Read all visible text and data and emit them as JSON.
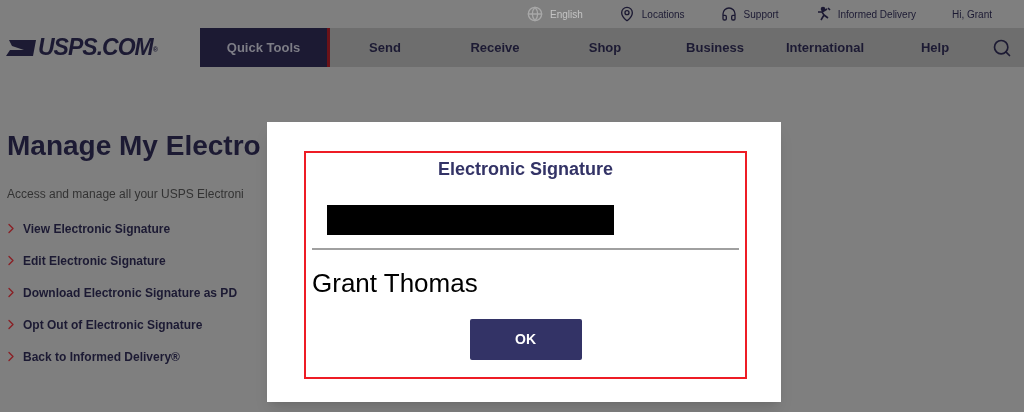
{
  "utility_bar": [
    {
      "kind": "language",
      "label": "English",
      "disabled": true
    },
    {
      "kind": "location",
      "label": "Locations",
      "disabled": false
    },
    {
      "kind": "support",
      "label": "Support",
      "disabled": false
    },
    {
      "kind": "delivery",
      "label": "Informed Delivery",
      "disabled": false
    },
    {
      "kind": "user",
      "label": "Hi, Grant",
      "disabled": false
    }
  ],
  "logo": {
    "text": "USPS.COM",
    "mark": "®"
  },
  "nav": [
    {
      "label": "Quick Tools",
      "selected": true
    },
    {
      "label": "Send",
      "selected": false
    },
    {
      "label": "Receive",
      "selected": false
    },
    {
      "label": "Shop",
      "selected": false
    },
    {
      "label": "Business",
      "selected": false
    },
    {
      "label": "International",
      "selected": false
    },
    {
      "label": "Help",
      "selected": false
    }
  ],
  "page": {
    "heading": "Manage My Electro",
    "intro": "Access and manage all your USPS Electroni",
    "links": [
      "View Electronic Signature",
      "Edit Electronic Signature",
      "Download Electronic Signature as PD",
      "Opt Out of Electronic Signature",
      "Back to Informed Delivery®"
    ]
  },
  "dialog": {
    "title": "Electronic Signature",
    "name": "Grant Thomas",
    "button": "OK"
  }
}
